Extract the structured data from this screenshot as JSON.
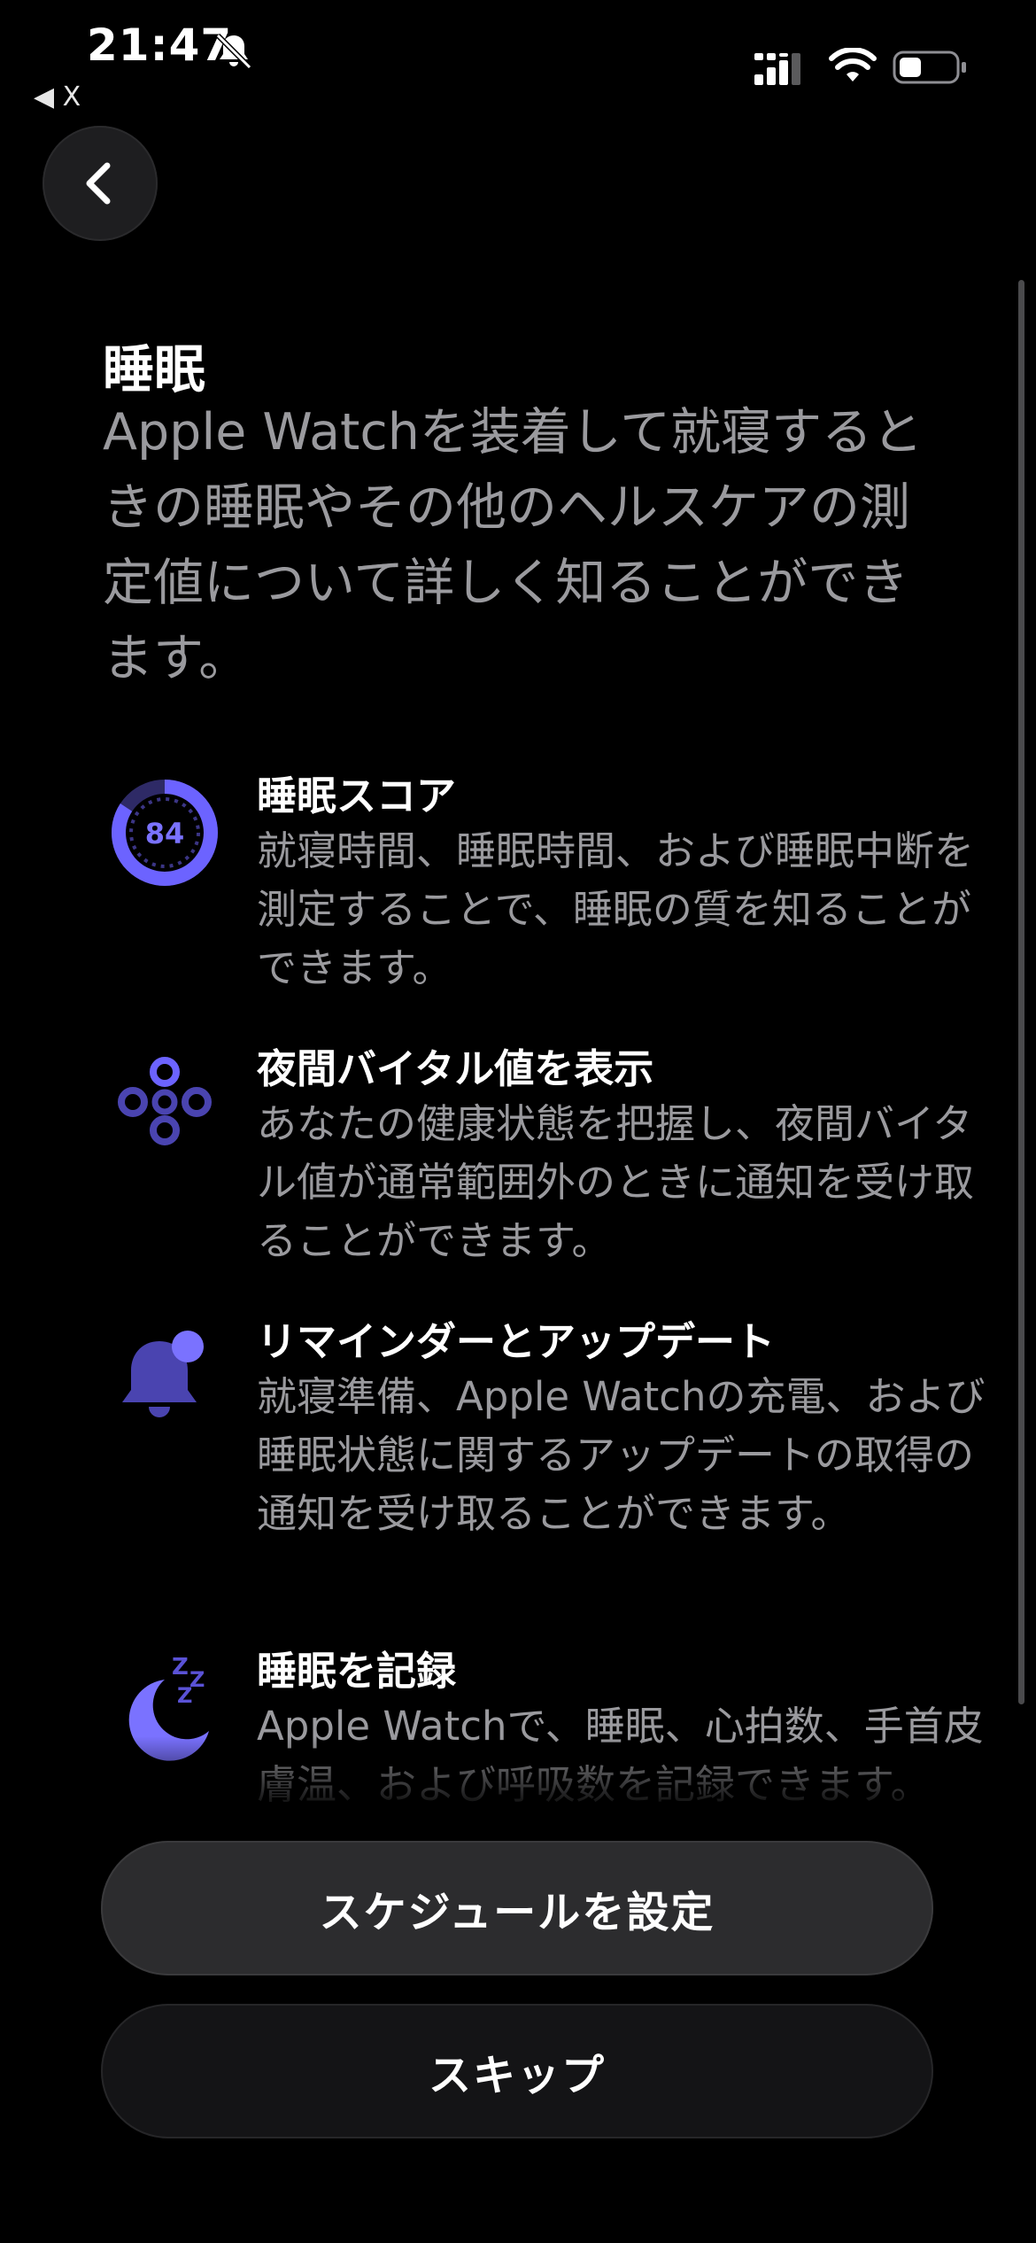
{
  "status_bar": {
    "time": "21:47",
    "back_app_label": "◀ X",
    "icons": [
      "bell-slash-icon",
      "cellular-signal-icon",
      "wifi-icon",
      "battery-icon"
    ]
  },
  "nav": {
    "back_icon": "chevron-left-icon"
  },
  "header": {
    "title": "睡眠",
    "intro": "Apple Watchを装着して就寝するときの睡眠やその他のヘルスケアの測定値について詳しく知ることができます。"
  },
  "features": [
    {
      "icon": "sleep-score-ring-icon",
      "icon_label": "84",
      "title": "睡眠スコア",
      "description": "就寝時間、睡眠時間、および睡眠中断を測定することで、睡眠の質を知ることができます。"
    },
    {
      "icon": "vitals-circles-icon",
      "title": "夜間バイタル値を表示",
      "description": "あなたの健康状態を把握し、夜間バイタル値が通常範囲外のときに通知を受け取ることができます。"
    },
    {
      "icon": "bell-badge-icon",
      "title": "リマインダーとアップデート",
      "description": "就寝準備、Apple Watchの充電、および睡眠状態に関するアップデートの取得の通知を受け取ることができます。"
    },
    {
      "icon": "moon-zzz-icon",
      "title": "睡眠を記録",
      "description": "Apple Watchで、睡眠、心拍数、手首皮膚温、および呼吸数を記録できます。"
    }
  ],
  "actions": {
    "primary": "スケジュールを設定",
    "secondary": "スキップ"
  },
  "colors": {
    "background": "#000000",
    "accent_purple": "#6c63ff",
    "secondary_text": "#9a9a9e",
    "button_fill": "#2c2c2e"
  }
}
